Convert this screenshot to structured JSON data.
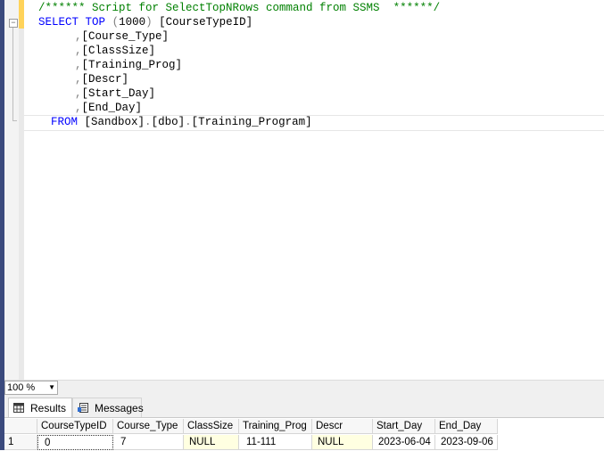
{
  "editor": {
    "comment": "/****** Script for SelectTopNRows command from SSMS  ******/",
    "select_kw": "SELECT",
    "top_kw": "TOP",
    "top_open": "(",
    "top_value": "1000",
    "top_close": ")",
    "first_column": "[CourseTypeID]",
    "columns": [
      "[Course_Type]",
      "[ClassSize]",
      "[Training_Prog]",
      "[Descr]",
      "[Start_Day]",
      "[End_Day]"
    ],
    "comma": ",",
    "from_kw": "FROM",
    "db": "[Sandbox]",
    "dot": ".",
    "schema": "[dbo]",
    "table": "[Training_Program]",
    "collapse_glyph": "−"
  },
  "zoom": {
    "value": "100 %",
    "arrow": "▼"
  },
  "tabs": [
    {
      "label": "Results"
    },
    {
      "label": "Messages"
    }
  ],
  "results": {
    "headers": [
      "CourseTypeID",
      "Course_Type",
      "ClassSize",
      "Training_Prog",
      "Descr",
      "Start_Day",
      "End_Day"
    ],
    "rows": [
      {
        "num": "1",
        "cells": [
          "0",
          "7",
          "NULL",
          "11-111",
          "NULL",
          "2023-06-04",
          "2023-09-06"
        ]
      }
    ]
  },
  "colors": {
    "keyword": "#0000ff",
    "comment": "#008000",
    "punct": "#808080",
    "null_bg": "#ffffe1",
    "rail": "#3b4a7d"
  }
}
